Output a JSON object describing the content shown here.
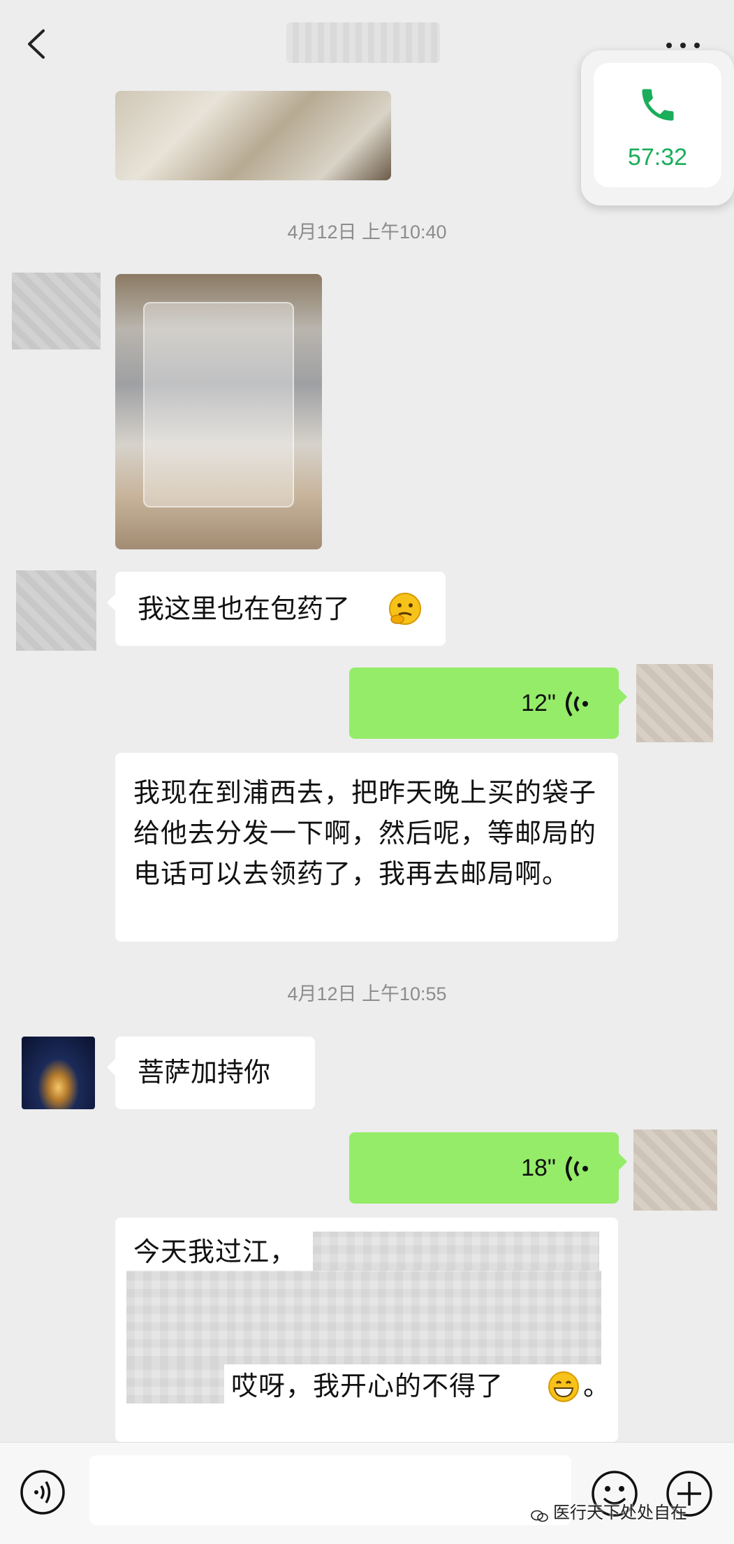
{
  "header": {
    "title": "",
    "back_icon": "chevron-left-icon",
    "more_icon": "more-horizontal-icon"
  },
  "call_float": {
    "duration": "57:32",
    "icon": "phone-icon",
    "accent": "#1aad5a"
  },
  "messages": {
    "timestamp1": "4月12日 上午10:40",
    "msg_packing": "我这里也在包药了",
    "voice1_length": "12\"",
    "voice1_transcript": "我现在到浦西去，把昨天晚上买的袋子给他去分发一下啊，然后呢，等邮局的电话可以去领药了，我再去邮局啊。",
    "timestamp2": "4月12日 上午10:55",
    "msg_bless": "菩萨加持你",
    "voice2_length": "18\"",
    "voice2_transcript_start": "今天我过江，",
    "voice2_transcript_end": "哎呀，我开心的不得了",
    "voice2_transcript_tail": "。"
  },
  "colors": {
    "background": "#ededed",
    "green_bubble": "#95ec69",
    "white_bubble": "#ffffff"
  },
  "footer": {
    "voice_icon": "voice-input-icon",
    "emoji_icon": "emoji-icon",
    "plus_icon": "plus-circle-icon",
    "watermark": "医行天下处处自在"
  }
}
